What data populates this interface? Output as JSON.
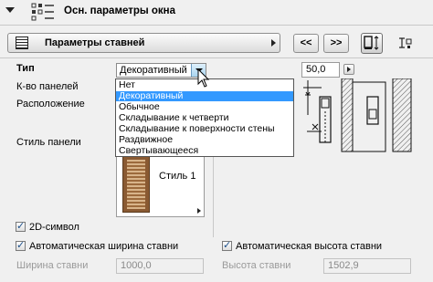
{
  "section": {
    "title": "Осн. параметры окна"
  },
  "panel_selector": {
    "title": "Параметры ставней"
  },
  "nav": {
    "prev": "<<",
    "next": ">>"
  },
  "labels": {
    "type": "Тип",
    "panel_count": "К-во панелей",
    "placement": "Расположение",
    "panel_style": "Стиль панели"
  },
  "type_dropdown": {
    "selected": "Декоративный",
    "options": [
      "Нет",
      "Декоративный",
      "Обычное",
      "Складывание к четверти",
      "Складывание к поверхности стены",
      "Раздвижное",
      "Свертывающееся"
    ],
    "highlighted_index": 1
  },
  "offset_field": {
    "value": "50,0"
  },
  "style_preview": {
    "label": "Стиль 1"
  },
  "checkboxes": {
    "symbol_2d": {
      "label": "2D-символ",
      "checked": true
    },
    "auto_width": {
      "label": "Автоматическая ширина ставни",
      "checked": true
    },
    "auto_height": {
      "label": "Автоматическая высота ставни",
      "checked": true
    }
  },
  "width": {
    "label": "Ширина ставни",
    "value": "1000,0"
  },
  "height": {
    "label": "Высота ставни",
    "value": "1502,9"
  },
  "colors": {
    "highlight": "#3399ff",
    "shutter": "#8a5a32"
  }
}
